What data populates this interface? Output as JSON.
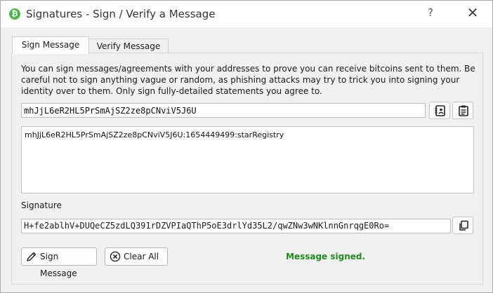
{
  "window": {
    "title": "Signatures - Sign / Verify a Message",
    "help_label": "?",
    "close_label": "✕",
    "app_icon_glyph": "₿"
  },
  "tabs": [
    {
      "label": "Sign Message",
      "active": true
    },
    {
      "label": "Verify Message",
      "active": false
    }
  ],
  "sign": {
    "description": "You can sign messages/agreements with your addresses to prove you can receive bitcoins sent to them. Be careful not to sign anything vague or random, as phishing attacks may try to trick you into signing your identity over to them. Only sign fully-detailed statements you agree to.",
    "address": "mhJjL6eR2HL5PrSmAjSZ2ze8pCNviV5J6U",
    "message": "mhJjL6eR2HL5PrSmAjSZ2ze8pCNviV5J6U:1654449499:starRegistry",
    "signature_label": "Signature",
    "signature": "H+fe2ablhV+DUQeCZ5zdLQ391rDZVPIaQThP5oE3drlYd35L2/qwZNw3wNKlnnGnrqgE0Ro=",
    "sign_button_label": "Sign Message",
    "clear_button_label": "Clear All",
    "status": "Message signed."
  },
  "icons": {
    "address_book": "address-book-icon",
    "paste": "paste-icon",
    "copy": "copy-icon",
    "sign": "pen-icon",
    "clear": "clear-circle-icon"
  },
  "colors": {
    "status_success": "#1f8b1f",
    "app_icon": "#4fb64a"
  }
}
